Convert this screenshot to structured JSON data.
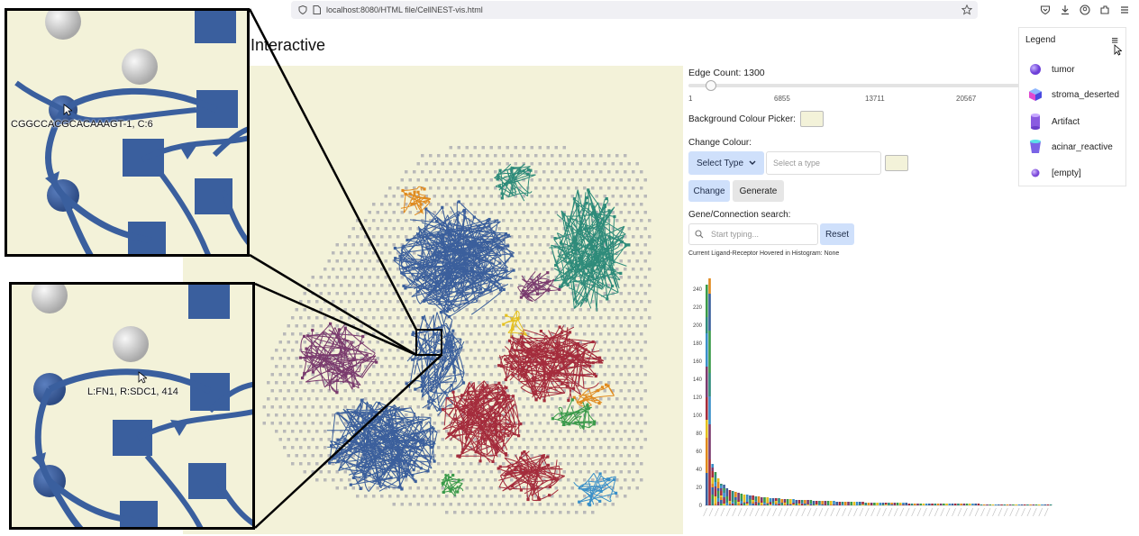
{
  "browser": {
    "url": "localhost:8080/HTML file/CellNEST-vis.html",
    "icons": [
      "shield-icon",
      "page-icon",
      "bookmark-star-icon",
      "pocket-icon",
      "download-icon",
      "account-icon",
      "extensions-icon",
      "menu-icon"
    ]
  },
  "page": {
    "title": "Interactive"
  },
  "controls": {
    "edge_count_label": "Edge Count: 1300",
    "slider": {
      "ticks": [
        "1",
        "6855",
        "13711",
        "20567"
      ],
      "value": 1300,
      "max": 27422
    },
    "bg_picker_label": "Background Colour Picker:",
    "bg_color": "#f3f2d9",
    "change_colour_label": "Change Colour:",
    "select_type_label": "Select Type",
    "type_input_placeholder": "Select a type",
    "change_button": "Change",
    "generate_button": "Generate",
    "search_label": "Gene/Connection search:",
    "search_placeholder": "Start typing...",
    "reset_button": "Reset",
    "hover_status": "Current Ligand-Receptor Hovered in Histogram: None"
  },
  "legend": {
    "title": "Legend",
    "items": [
      {
        "label": "tumor",
        "shape": "sphere",
        "color": "#8a63e8"
      },
      {
        "label": "stroma_deserted",
        "shape": "cube",
        "color": "#6a6ae6"
      },
      {
        "label": "Artifact",
        "shape": "cylinder",
        "color": "#8a5be0"
      },
      {
        "label": "acinar_reactive",
        "shape": "cup",
        "color": "#4fd0e6"
      },
      {
        "label": "[empty]",
        "shape": "small-sphere",
        "color": "#9a6ae6"
      }
    ]
  },
  "insets": {
    "top_tooltip": "CGGCCACGCACAAAGT-1, C:6",
    "bottom_tooltip": "L:FN1, R:SDC1, 414"
  },
  "chart_data": {
    "type": "bar",
    "title": "",
    "xlabel": "",
    "ylabel": "",
    "ylim": [
      0,
      250
    ],
    "yticks": [
      0,
      20,
      40,
      60,
      80,
      100,
      120,
      140,
      160,
      180,
      200,
      220,
      240
    ],
    "colors": {
      "c1": "#3b5f9c",
      "c2": "#a42c3c",
      "c3": "#2e8b7a",
      "c4": "#e08a1e",
      "c5": "#7a3b6e",
      "c6": "#3a9a4a",
      "c7": "#e4c020",
      "c8": "#3a8fc8"
    },
    "values": [
      245,
      232,
      46,
      35,
      28,
      24,
      21,
      19,
      17,
      16,
      15,
      14,
      13,
      12,
      12,
      11,
      11,
      10,
      10,
      9,
      9,
      9,
      8,
      8,
      8,
      8,
      7,
      7,
      7,
      7,
      7,
      6,
      6,
      6,
      6,
      6,
      6,
      5,
      5,
      5,
      5,
      5,
      5,
      5,
      5,
      4,
      4,
      4,
      4,
      4,
      4,
      4,
      4,
      4,
      4,
      3,
      3,
      3,
      3,
      3,
      3,
      3,
      3,
      3,
      3,
      3,
      3,
      3,
      3,
      3,
      2,
      2,
      2,
      2,
      2,
      2,
      2,
      2,
      2,
      2,
      2,
      2,
      2,
      2,
      2,
      2,
      2,
      2,
      2,
      2,
      2,
      2,
      2,
      2,
      2,
      1,
      1,
      1,
      1,
      1,
      1,
      1,
      1,
      1,
      1,
      1,
      1,
      1,
      1,
      1,
      1,
      1,
      1,
      1,
      1,
      1,
      1,
      1,
      1,
      1
    ]
  }
}
